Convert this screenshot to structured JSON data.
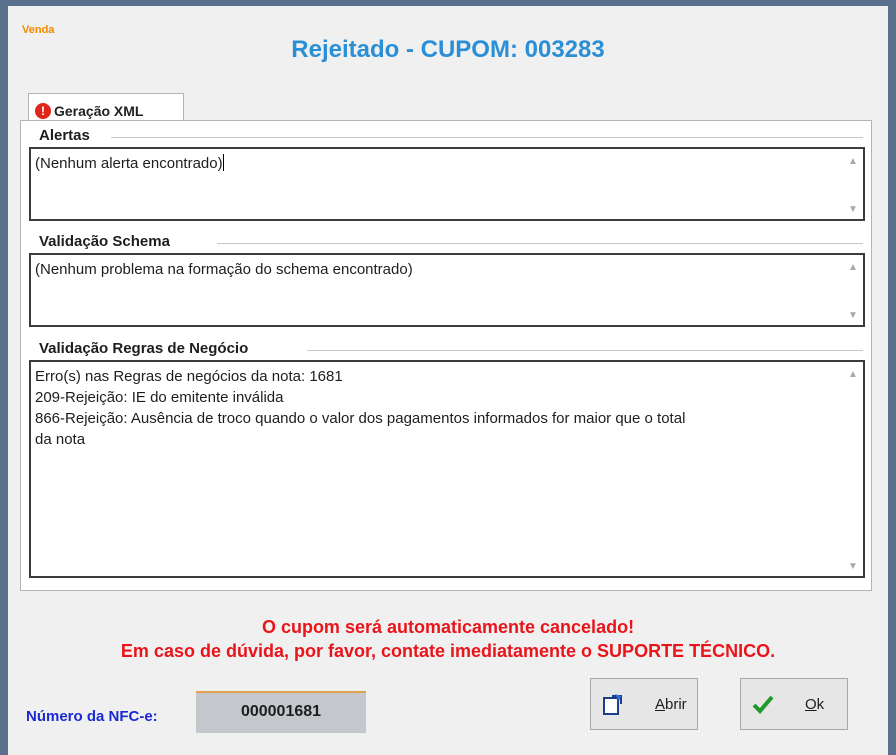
{
  "window": {
    "app_tag": "Venda",
    "title": "Rejeitado - CUPOM: 003283"
  },
  "tab": {
    "label": "Geração XML",
    "icon": "error-icon"
  },
  "groups": {
    "alertas": {
      "label": "Alertas",
      "text": "(Nenhum alerta encontrado)"
    },
    "schema": {
      "label": "Validação Schema",
      "text": "(Nenhum problema na formação do schema encontrado)"
    },
    "regras": {
      "label": "Validação Regras de Negócio",
      "lines": [
        "Erro(s) nas Regras de negócios da nota: 1681",
        "209-Rejeição: IE do emitente inválida",
        "866-Rejeição: Ausência de troco quando o valor dos pagamentos informados for maior que o total",
        "da nota"
      ]
    }
  },
  "warning": {
    "line1": "O cupom será automaticamente cancelado!",
    "line2": "Em caso de dúvida, por favor, contate imediatamente o SUPORTE TÉCNICO."
  },
  "footer": {
    "nfce_label": "Número da NFC-e:",
    "nfce_value": "000001681",
    "abrir_mnemonic": "A",
    "abrir_rest": "brir",
    "ok_mnemonic": "O",
    "ok_rest": "k"
  },
  "colors": {
    "title": "#2b8fd6",
    "warning": "#e8151b",
    "nfce_label": "#1a2ad0",
    "app_tag": "#f08a00"
  }
}
